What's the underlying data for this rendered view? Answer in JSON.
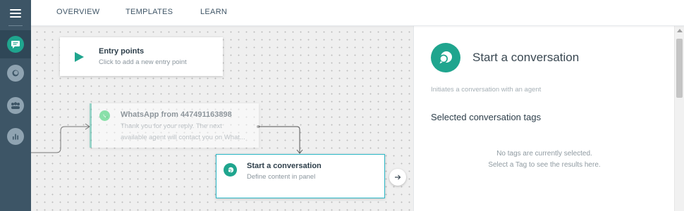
{
  "nav": {
    "tabs": [
      {
        "label": "OVERVIEW"
      },
      {
        "label": "TEMPLATES"
      },
      {
        "label": "LEARN"
      }
    ]
  },
  "sidebar": {
    "items": [
      {
        "icon": "menu-icon"
      },
      {
        "icon": "flows-chat-icon",
        "active": true
      },
      {
        "icon": "conversations-icon"
      },
      {
        "icon": "people-icon"
      },
      {
        "icon": "analytics-icon"
      }
    ]
  },
  "canvas": {
    "entry_node": {
      "title": "Entry points",
      "subtitle": "Click to add a new entry point",
      "icon": "play-icon"
    },
    "whatsapp_node": {
      "title": "WhatsApp from 447491163898",
      "line1": "Thank you for your reply. The next",
      "line2": "available agent will contact you on What...",
      "icon": "whatsapp-icon"
    },
    "start_node": {
      "title": "Start a conversation",
      "subtitle": "Define content in panel",
      "icon": "conversation-icon"
    },
    "next_button": {
      "icon": "arrow-right-icon"
    }
  },
  "panel": {
    "title": "Start a conversation",
    "description": "Initiates a conversation with an agent",
    "section_title": "Selected conversation tags",
    "empty_line1": "No tags are currently selected.",
    "empty_line2": "Select a Tag to see the results here."
  },
  "colors": {
    "rail": "#3d5566",
    "accent_green": "#1fa58e",
    "selected_border": "#2bb7c6",
    "play": "#1fa58e"
  }
}
